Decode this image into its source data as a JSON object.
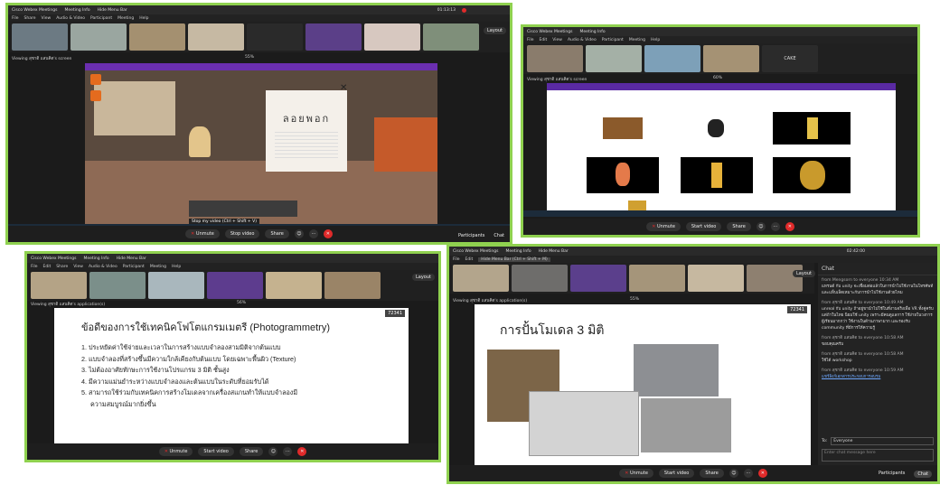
{
  "colors": {
    "frame": "#8fd14f",
    "leave": "#e02a2a",
    "app_bg": "#1b1b1b"
  },
  "common": {
    "app_name": "Cisco Webex Meetings",
    "meeting_info": "Meeting Info",
    "hide_menu": "Hide Menu Bar",
    "menu": [
      "File",
      "Edit",
      "Share",
      "View",
      "Audio & Video",
      "Participant",
      "Meeting",
      "Help"
    ],
    "unmute": "Unmute",
    "stop_video": "Stop video",
    "start_video": "Start video",
    "share": "Share",
    "participants": "Participants",
    "chat": "Chat",
    "layout": "Layout",
    "more": "···",
    "zoom": "55%"
  },
  "top_left": {
    "time": "01:13:13",
    "viewing": "Viewing สุชาติ แสนคิต's screen",
    "panel_title": "ลอยพอก",
    "tooltip": "Stop my video (Ctrl + Shift + V)"
  },
  "top_right": {
    "viewing": "Viewing สุชาติ แสนคิต's screen",
    "zoom": "60%",
    "cake_label": "CAKE"
  },
  "bottom_left": {
    "viewing": "Viewing สุชาติ แสนคิต's application(s)",
    "zoom": "56%",
    "tag": "72341",
    "slide_title": "ข้อดีของการใช้เทคนิคโฟโตแกรมเมตรี (Photogrammetry)",
    "points": [
      "1. ประหยัดค่าใช้จ่ายและเวลาในการสร้างแบบจำลองสามมิติจากต้นแบบ",
      "2. แบบจำลองที่สร้างขึ้นมีความใกล้เคียงกับต้นแบบ โดยเฉพาะพื้นผิว (Texture)",
      "3. ไม่ต้องอาศัยทักษะการใช้งานโปรแกรม 3 มิติ ชั้นสูง",
      "4. มีความแม่นยำระหว่างแบบจำลองและต้นแบบในระดับที่ยอมรับได้",
      "5. สามารถใช้ร่วมกับเทคนิคการสร้างโมเดลจากเครื่องสแกนทำให้แบบจำลองมี",
      "ความสมบูรณ์มากยิ่งขึ้น"
    ]
  },
  "bottom_right": {
    "time": "02:42:00",
    "hide_menu": "Hide Menu Bar (Ctrl + Shift + M)",
    "viewing": "Viewing สุชาติ แสนคิต's application(s)",
    "zoom": "55%",
    "tag": "72341",
    "slide_title": "การปั้นโมเดล 3 มิติ",
    "chat_title": "Chat",
    "chat_messages": [
      {
        "from": "from Mengsorn to everyone   10:34 AM",
        "text": "แทรนด์ กับ unity จะเชื่อมต่อแล้วในการนำไปใช้งานในโทรศัพท์และแท็บเล็ตเหมาะกับการนำไปใช้งานด้วยไหม"
      },
      {
        "from": "from สุชาติ แสนคิต to everyone   10:49 AM",
        "text": "unreal กับ unity ถ้าอยู่ขานำไปใช้ในที่งานจริงเพื่อ VR ทั้งคู่ครับ แต่ถ้าในไทย นิยมใช้ unity เพราะมีคนดูแลการ ใช้ง่ายในวงการ ผู้เรียนมากกว่า ใช้งานในด้านภาษามาก และรองรับ community ที่มีการให้ความรู้"
      },
      {
        "from": "from สุชาติ แสนคิต to everyone   10:58 AM",
        "text": "ขอบคุณครับ"
      },
      {
        "from": "from สุชาติ แสนคิต to everyone   10:58 AM",
        "text": "ใช้ได้ workshop"
      },
      {
        "from": "from สุชาติ แสนคิต to everyone   10:59 AM",
        "text": "แชร์ลิงก์เอกสารประกอบการอบรม"
      }
    ],
    "to_label": "To:",
    "to_value": "Everyone",
    "input_placeholder": "Enter chat message here"
  }
}
